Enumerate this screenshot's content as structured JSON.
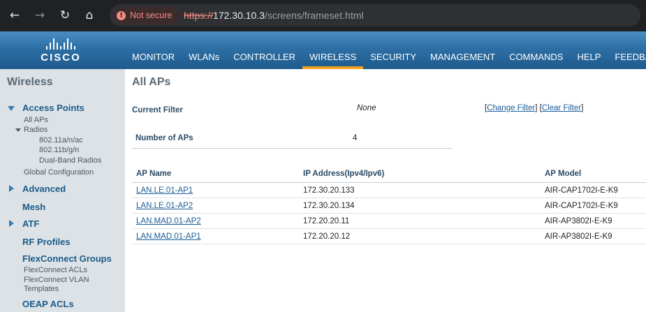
{
  "browser": {
    "security_label": "Not secure",
    "url_scheme": "https://",
    "url_host": "172.30.10.3",
    "url_path": "/screens/frameset.html",
    "icons": [
      "back-arrow-icon",
      "forward-arrow-icon",
      "reload-icon",
      "home-icon",
      "warning-icon"
    ]
  },
  "brand": {
    "logo_text": "CISCO"
  },
  "topnav": {
    "items": [
      "MONITOR",
      "WLANs",
      "CONTROLLER",
      "WIRELESS",
      "SECURITY",
      "MANAGEMENT",
      "COMMANDS",
      "HELP",
      "FEEDBACK"
    ],
    "active": "WIRELESS",
    "accent_color": "#f0a020"
  },
  "leftmenu": {
    "title": "Wireless",
    "access_points": "Access Points",
    "all_aps": "All APs",
    "radios": "Radios",
    "radio_a": "802.11a/n/ac",
    "radio_b": "802.11b/g/n",
    "radio_dual": "Dual-Band Radios",
    "global_config": "Global Configuration",
    "advanced": "Advanced",
    "mesh": "Mesh",
    "atf": "ATF",
    "rf_profiles": "RF Profiles",
    "flexconnect_groups": "FlexConnect Groups",
    "flexconnect_acls": "FlexConnect ACLs",
    "flexconnect_vlan_1": "FlexConnect VLAN",
    "flexconnect_vlan_2": "Templates",
    "oeap_acls": "OEAP ACLs"
  },
  "main": {
    "title": "All APs",
    "current_filter_label": "Current Filter",
    "current_filter_value": "None",
    "change_filter": "Change Filter",
    "clear_filter": "Clear Filter",
    "bracket_open": "[",
    "bracket_close": "]",
    "num_aps_label": "Number of APs",
    "num_aps_value": "4",
    "table": {
      "columns": [
        "AP Name",
        "IP Address(Ipv4/Ipv6)",
        "AP Model"
      ],
      "rows": [
        [
          "LAN.LE.01-AP1",
          "172.30.20.133",
          "AIR-CAP1702I-E-K9"
        ],
        [
          "LAN.LE.01-AP2",
          "172.30.20.134",
          "AIR-CAP1702I-E-K9"
        ],
        [
          "LAN.MAD.01-AP2",
          "172.20.20.11",
          "AIR-AP3802I-E-K9"
        ],
        [
          "LAN.MAD.01-AP1",
          "172.20.20.12",
          "AIR-AP3802I-E-K9"
        ]
      ]
    }
  }
}
